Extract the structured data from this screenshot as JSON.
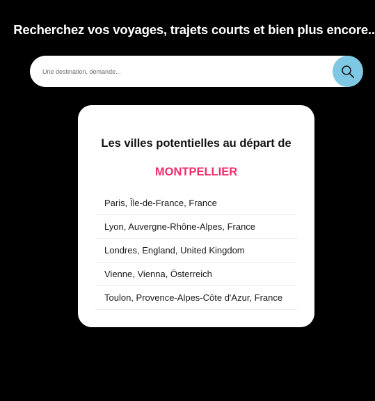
{
  "header": {
    "headline": "Recherchez vos voyages, trajets courts et bien plus encore..."
  },
  "search": {
    "placeholder": "Une destination, demande...",
    "value": "",
    "button_icon": "search-icon",
    "button_color": "#7ec8e3"
  },
  "card": {
    "title": "Les villes potentielles au départ de",
    "city": "MONTPELLIER",
    "city_color": "#ef2d6b",
    "destinations": [
      "Paris, Île-de-France, France",
      "Lyon, Auvergne-Rhône-Alpes, France",
      "Londres, England, United Kingdom",
      "Vienne, Vienna, Österreich",
      "Toulon, Provence-Alpes-Côte d'Azur, France"
    ]
  }
}
